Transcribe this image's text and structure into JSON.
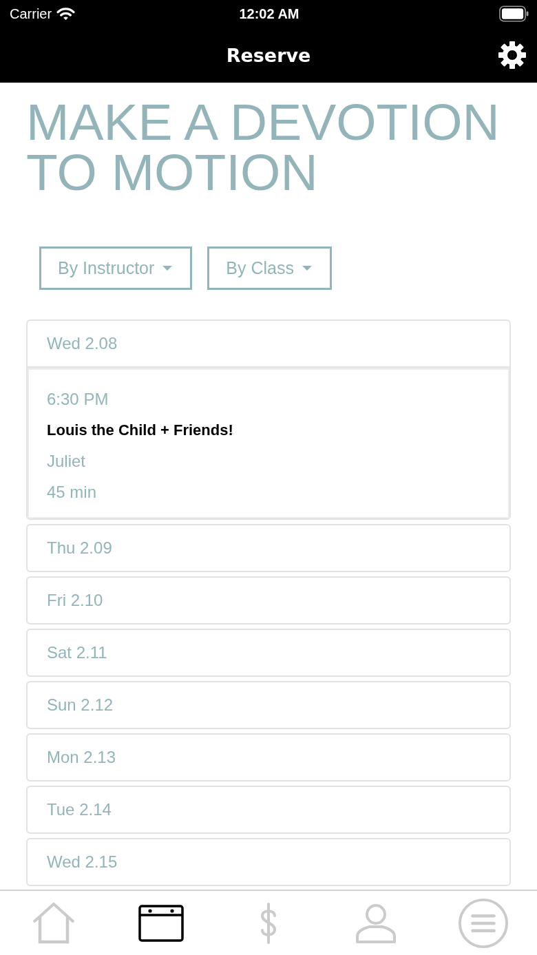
{
  "status_bar": {
    "carrier": "Carrier",
    "time": "12:02 AM"
  },
  "nav_bar": {
    "title": "Reserve"
  },
  "headline": "MAKE A DEVOTION TO MOTION",
  "filters": [
    {
      "label": "By Instructor"
    },
    {
      "label": "By Class"
    }
  ],
  "days": [
    {
      "label": "Wed 2.08",
      "expanded": true,
      "classes": [
        {
          "time": "6:30 PM",
          "name": "Louis the Child + Friends!",
          "instructor": "Juliet",
          "duration": "45 min"
        }
      ]
    },
    {
      "label": "Thu 2.09",
      "expanded": false
    },
    {
      "label": "Fri 2.10",
      "expanded": false
    },
    {
      "label": "Sat 2.11",
      "expanded": false
    },
    {
      "label": "Sun 2.12",
      "expanded": false
    },
    {
      "label": "Mon 2.13",
      "expanded": false
    },
    {
      "label": "Tue 2.14",
      "expanded": false
    },
    {
      "label": "Wed 2.15",
      "expanded": false
    }
  ],
  "tab_bar": [
    {
      "kind": "home",
      "selected": false
    },
    {
      "kind": "calendar",
      "selected": true
    },
    {
      "kind": "dollar",
      "selected": false
    },
    {
      "kind": "person",
      "selected": false
    },
    {
      "kind": "menu",
      "selected": false
    }
  ]
}
